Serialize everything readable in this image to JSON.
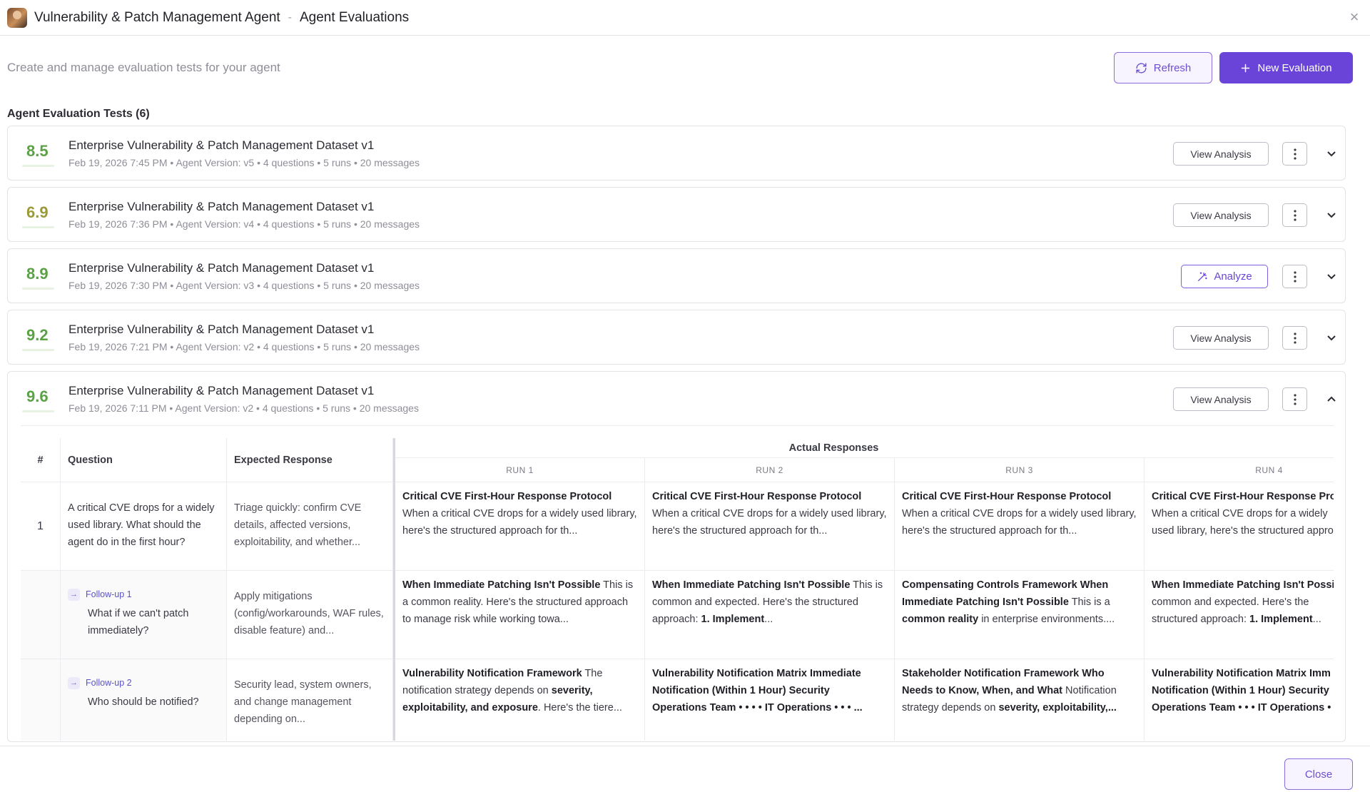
{
  "header": {
    "title": "Vulnerability & Patch Management Agent",
    "separator": "-",
    "subtitle": "Agent Evaluations"
  },
  "intro": "Create and manage evaluation tests for your agent",
  "toolbar": {
    "refresh_label": "Refresh",
    "new_label": "New Evaluation"
  },
  "section_title": "Agent Evaluation Tests (6)",
  "evaluations": [
    {
      "score": "8.5",
      "title": "Enterprise Vulnerability & Patch Management Dataset v1",
      "meta": "Feb 19, 2026 7:45 PM • Agent Version: v5 • 4 questions • 5 runs • 20 messages",
      "action": "View Analysis"
    },
    {
      "score": "6.9",
      "title": "Enterprise Vulnerability & Patch Management Dataset v1",
      "meta": "Feb 19, 2026 7:36 PM • Agent Version: v4 • 4 questions • 5 runs • 20 messages",
      "action": "View Analysis"
    },
    {
      "score": "8.9",
      "title": "Enterprise Vulnerability & Patch Management Dataset v1",
      "meta": "Feb 19, 2026 7:30 PM • Agent Version: v3 • 4 questions • 5 runs • 20 messages",
      "action": "Analyze"
    },
    {
      "score": "9.2",
      "title": "Enterprise Vulnerability & Patch Management Dataset v1",
      "meta": "Feb 19, 2026 7:21 PM • Agent Version: v2 • 4 questions • 5 runs • 20 messages",
      "action": "View Analysis"
    },
    {
      "score": "9.6",
      "title": "Enterprise Vulnerability & Patch Management Dataset v1",
      "meta": "Feb 19, 2026 7:11 PM • Agent Version: v2 • 4 questions • 5 runs • 20 messages",
      "action": "View Analysis"
    }
  ],
  "table": {
    "col_num": "#",
    "col_question": "Question",
    "col_expected": "Expected Response",
    "col_actual": "Actual Responses",
    "runs": [
      "RUN 1",
      "RUN 2",
      "RUN 3",
      "RUN 4"
    ],
    "rows": [
      {
        "num": "1",
        "question": "A critical CVE drops for a widely used library. What should the agent do in the first hour?",
        "expected": "Triage quickly: confirm CVE details, affected versions, exploitability, and whether...",
        "responses": [
          {
            "bold": "Critical CVE First-Hour Response Protocol",
            "text": "When a critical CVE drops for a widely used library, here's the structured approach for th..."
          },
          {
            "bold": "Critical CVE First-Hour Response Protocol",
            "text": "When a critical CVE drops for a widely used library, here's the structured approach for th..."
          },
          {
            "bold": "Critical CVE First-Hour Response Protocol",
            "text": "When a critical CVE drops for a widely used library, here's the structured approach for th..."
          },
          {
            "bold": "Critical CVE First-Hour Response Pro",
            "text": "When a critical CVE drops for a widely used library, here's the structured approach"
          }
        ]
      },
      {
        "followup": "Follow-up 1",
        "question": "What if we can't patch immediately?",
        "expected": "Apply mitigations (config/workarounds, WAF rules, disable feature) and...",
        "responses": [
          {
            "bold": "When Immediate Patching Isn't Possible",
            "text": "This is a common reality. Here's the structured approach to manage risk while working towa..."
          },
          {
            "bold": "When Immediate Patching Isn't Possible",
            "text": "This is common and expected. Here's the structured approach:",
            "tail_bold": "1. Implement",
            "tail": "..."
          },
          {
            "bold": "Compensating Controls Framework When Immediate Patching Isn't Possible",
            "text": "This is a",
            "tail_bold": "common reality",
            "tail": "in enterprise environments...."
          },
          {
            "bold": "When Immediate Patching Isn't Possi",
            "text": "is common and expected. Here's the structured approach:",
            "tail_bold": "1. Implement",
            "tail": "..."
          }
        ]
      },
      {
        "followup": "Follow-up 2",
        "question": "Who should be notified?",
        "expected": "Security lead, system owners, and change management depending on...",
        "responses": [
          {
            "bold": "Vulnerability Notification Framework",
            "text": "The notification strategy depends on",
            "tail_bold": "severity, exploitability, and exposure",
            "tail": ". Here's the tiere..."
          },
          {
            "bold": "Vulnerability Notification Matrix Immediate Notification (Within 1 Hour) Security Operations Team • • • • IT Operations • • • ...",
            "text": ""
          },
          {
            "bold": "Stakeholder Notification Framework Who Needs to Know, When, and What",
            "text": "Notification strategy depends on",
            "tail_bold": "severity, exploitability,...",
            "tail": ""
          },
          {
            "bold": "Vulnerability Notification Matrix Imm Notification (Within 1 Hour) Security Operations Team • • • IT Operations •",
            "text": ""
          }
        ]
      }
    ]
  },
  "footer": {
    "close_label": "Close"
  },
  "colors": {
    "accent": "#6a44d8",
    "score_green": "#5aa245",
    "score_olive": "#9a9a38"
  }
}
